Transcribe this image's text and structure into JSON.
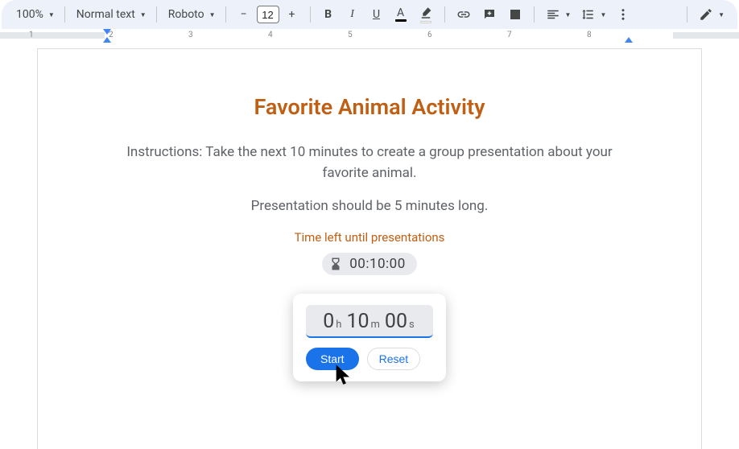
{
  "toolbar": {
    "zoom": "100%",
    "style": "Normal text",
    "font": "Roboto",
    "size": "12",
    "minus": "−",
    "plus": "+",
    "bold": "B",
    "italic": "I",
    "underline": "U",
    "text_color_letter": "A",
    "text_color_bar": "#000000",
    "highlight_bar": "#ffffff"
  },
  "ruler": {
    "numbers": [
      "1",
      "2",
      "3",
      "4",
      "5",
      "6",
      "7",
      "8"
    ]
  },
  "document": {
    "title": "Favorite Animal Activity",
    "para1": "Instructions: Take the next 10 minutes to create a group presentation about your favorite animal.",
    "para2": "Presentation should be 5 minutes long.",
    "subtitle": "Time left until presentations",
    "timer_value": "00:10:00"
  },
  "timer_popup": {
    "h": "0",
    "h_label": "h",
    "m": "10",
    "m_label": "m",
    "s": "00",
    "s_label": "s",
    "start": "Start",
    "reset": "Reset"
  }
}
